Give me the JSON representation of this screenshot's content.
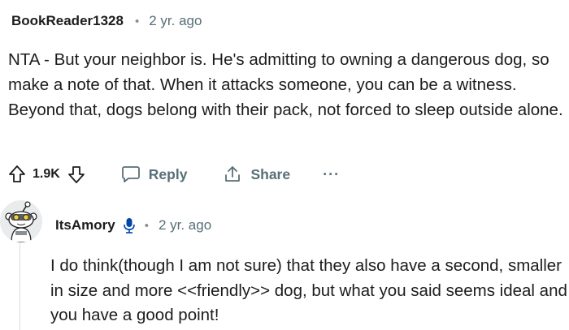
{
  "comment1": {
    "username": "BookReader1328",
    "age": "2 yr. ago",
    "body": "NTA - But your neighbor is. He's admitting to owning a dangerous dog, so make a note of that. When it attacks someone, you can be a witness. Beyond that, dogs belong with their pack, not forced to sleep outside alone.",
    "votes": "1.9K",
    "reply_label": "Reply",
    "share_label": "Share",
    "more_label": "···"
  },
  "comment2": {
    "username": "ItsAmory",
    "age": "2 yr. ago",
    "body": "I do think(though I am not sure) that they also have a second, smaller in size and more <<friendly>> dog, but what you said seems ideal and you have a good point!"
  },
  "separator": "•",
  "icons": {
    "upvote": "upvote-arrow-icon",
    "downvote": "downvote-arrow-icon",
    "reply": "speech-bubble-icon",
    "share": "share-icon",
    "more": "more-dots-icon",
    "mic": "microphone-icon",
    "avatar": "snoo-avatar-icon"
  },
  "colors": {
    "text": "#1c1c1c",
    "meta": "#576f76",
    "mic": "#0045ac",
    "thread": "#d6dadc"
  }
}
